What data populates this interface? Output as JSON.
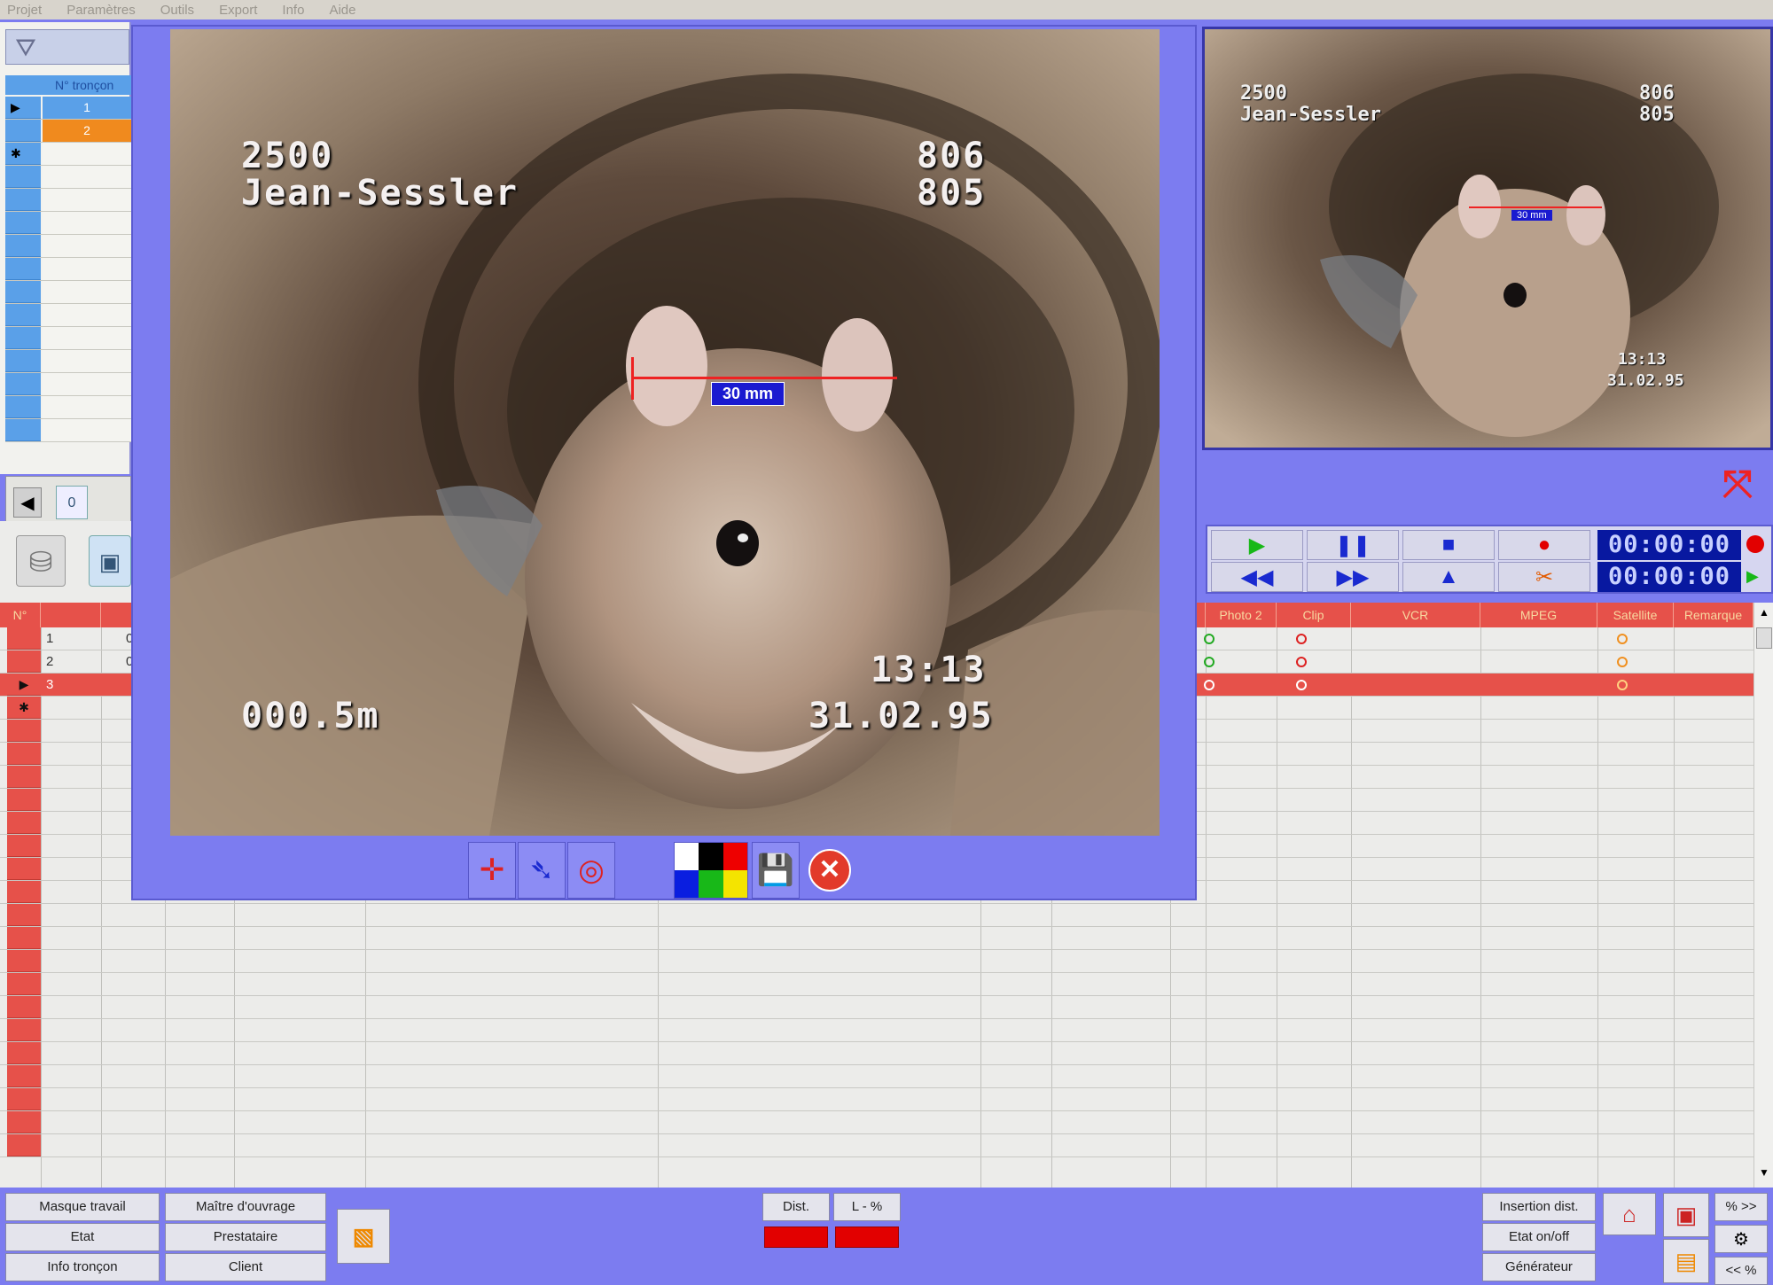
{
  "menu": [
    "Projet",
    "Paramètres",
    "Outils",
    "Export",
    "Info",
    "Aide"
  ],
  "left_panel": {
    "tr_header": "N° tronçon",
    "tr_rows": [
      "1",
      "2",
      "",
      "",
      "",
      "",
      "",
      "",
      "",
      "",
      "",
      "",
      "",
      "",
      ""
    ],
    "tr_counter": "0"
  },
  "video": {
    "osd_code": "2500",
    "osd_name": "Jean-Sessler",
    "osd_num1": "806",
    "osd_num2": "805",
    "osd_time": "13:13",
    "osd_date": "31.02.95",
    "osd_dist": "000.5m",
    "measure_label": "30 mm",
    "colors": {
      "frame_bg": "#7c7cf0",
      "measure": "#e22222",
      "label_bg": "#1a1ad0"
    }
  },
  "preview": {
    "osd_code": "2500",
    "osd_name": "Jean-Sessler",
    "osd_num1": "806",
    "osd_num2": "805",
    "measure_label": "30 mm",
    "osd_time": "13:13",
    "osd_date": "31.02.95"
  },
  "player": {
    "timecode_top": "00:00:00",
    "timecode_bottom": "00:00:00"
  },
  "grid": {
    "headers": [
      "N°",
      "",
      "",
      "",
      "",
      "",
      "",
      "",
      "",
      "",
      "Photo 2",
      "Clip",
      "VCR",
      "MPEG",
      "Satellite",
      "Remarque"
    ],
    "rows": [
      {
        "num": "1",
        "c2": "0"
      },
      {
        "num": "2",
        "c2": "0"
      },
      {
        "num": "3",
        "c2": ""
      }
    ]
  },
  "bottom": {
    "col1": [
      "Masque travail",
      "Etat",
      "Info tronçon"
    ],
    "col2": [
      "Maître d'ouvrage",
      "Prestataire",
      "Client"
    ],
    "dist_label": "Dist.",
    "l_label": "L - %",
    "right_col": [
      "Insertion dist.",
      "Etat on/off",
      "Générateur"
    ],
    "pct_fwd": "% >>",
    "pct_back": "<< %"
  }
}
